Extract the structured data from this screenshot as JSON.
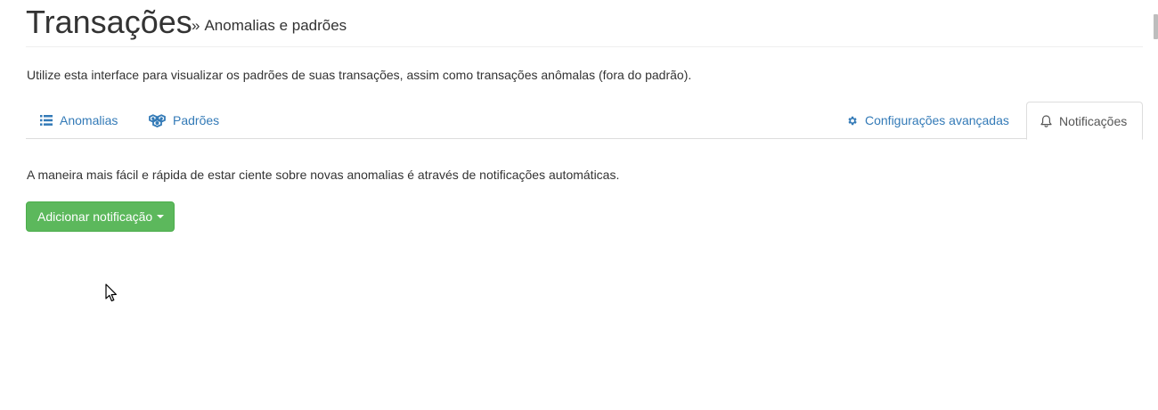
{
  "header": {
    "title": "Transações",
    "separator": "»",
    "subtitle": "Anomalias e padrões"
  },
  "intro_text": "Utilize esta interface para visualizar os padrões de suas transações, assim como transações anômalas (fora do padrão).",
  "tabs": [
    {
      "label": "Anomalias",
      "icon": "list-icon",
      "active": false
    },
    {
      "label": "Padrões",
      "icon": "cubes-icon",
      "active": false
    },
    {
      "label": "Configurações avançadas",
      "icon": "gear-icon",
      "active": false
    },
    {
      "label": "Notificações",
      "icon": "bell-icon",
      "active": true
    }
  ],
  "notifications": {
    "description": "A maneira mais fácil e rápida de estar ciente sobre novas anomalias é através de notificações automáticas.",
    "add_button_label": "Adicionar notificação"
  },
  "colors": {
    "link": "#337ab7",
    "success": "#5cb85c",
    "text": "#333333"
  }
}
